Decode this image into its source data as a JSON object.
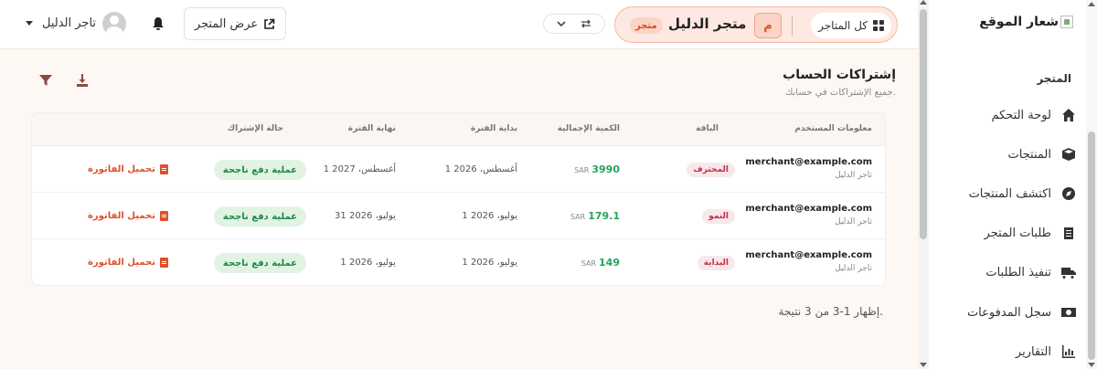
{
  "sidebar": {
    "logo_text": "شعار الموقع",
    "section_label": "المتجر",
    "items": [
      {
        "label": "لوحة التحكم",
        "icon": "home-icon"
      },
      {
        "label": "المنتجات",
        "icon": "box-icon"
      },
      {
        "label": "اكتشف المنتجات",
        "icon": "compass-icon"
      },
      {
        "label": "طلبات المتجر",
        "icon": "clipboard-icon"
      },
      {
        "label": "تنفيذ الطلبات",
        "icon": "truck-icon"
      },
      {
        "label": "سجل المدفوعات",
        "icon": "money-icon"
      },
      {
        "label": "التقارير",
        "icon": "chart-icon"
      }
    ]
  },
  "topbar": {
    "all_stores_label": "كل المتاجر",
    "store_initial": "م",
    "store_name": "متجر الدليل",
    "store_badge": "متجر",
    "view_store_label": "عرض المتجر",
    "user_name": "تاجر الدليل"
  },
  "page": {
    "title": "إشتراكات الحساب",
    "subtitle": "جميع الإشتراكات في حسابك.",
    "pager_text": "إظهار 1-3 من 3 نتيجة."
  },
  "table": {
    "headers": {
      "user": "معلومات المستخدم",
      "plan": "الباقة",
      "amount": "الكمية الإجمالية",
      "start": "بداية الفترة",
      "end": "نهاية الفترة",
      "status": "حالة الإشتراك"
    },
    "rows": [
      {
        "email": "merchant@example.com",
        "name": "تاجر الدليل",
        "plan": "المحترف",
        "amount": "3990",
        "currency": "SAR",
        "start": "1 أغسطس، 2026",
        "end": "1 أغسطس، 2027",
        "status": "عملية دفع ناجحة",
        "invoice": "تحميل الفاتورة"
      },
      {
        "email": "merchant@example.com",
        "name": "تاجر الدليل",
        "plan": "النمو",
        "amount": "179.1",
        "currency": "SAR",
        "start": "1 يوليو، 2026",
        "end": "31 يوليو، 2026",
        "status": "عملية دفع ناجحة",
        "invoice": "تحميل الفاتورة"
      },
      {
        "email": "merchant@example.com",
        "name": "تاجر الدليل",
        "plan": "البداية",
        "amount": "149",
        "currency": "SAR",
        "start": "1 يوليو، 2026",
        "end": "1 يوليو، 2026",
        "status": "عملية دفع ناجحة",
        "invoice": "تحميل الفاتورة"
      }
    ]
  },
  "colors": {
    "accent": "#e0512a",
    "success": "#24a35a",
    "background": "#fdf8f3"
  }
}
